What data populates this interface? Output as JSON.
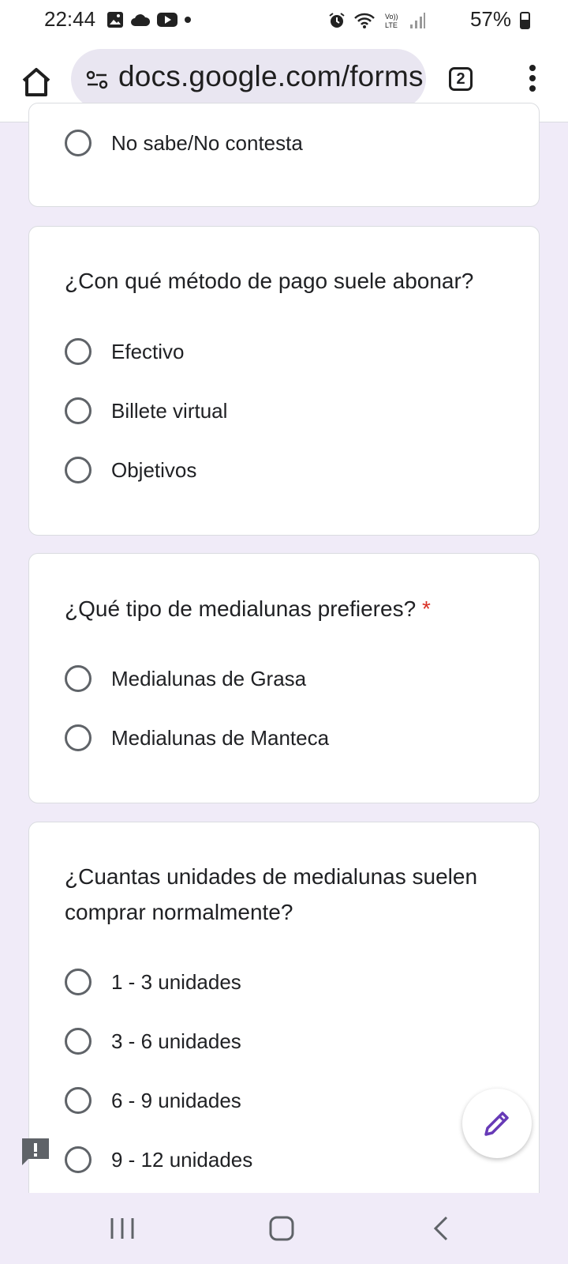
{
  "status_bar": {
    "time": "22:44",
    "battery": "57%",
    "left_icons": [
      "gallery-icon",
      "cloud-icon",
      "youtube-icon",
      "dot-icon"
    ],
    "right_icons": [
      "alarm-icon",
      "wifi-icon",
      "volte-icon",
      "signal-icon",
      "battery-icon"
    ]
  },
  "browser": {
    "url": "docs.google.com/forms",
    "tab_count": "2"
  },
  "form": {
    "partial_option": "No sabe/No contesta",
    "q1": {
      "question": "¿Con qué método de pago suele abonar?",
      "options": [
        "Efectivo",
        "Billete virtual",
        "Objetivos"
      ]
    },
    "q2": {
      "question": "¿Qué tipo de medialunas prefieres?",
      "required_mark": "*",
      "options": [
        "Medialunas de Grasa",
        "Medialunas de Manteca"
      ]
    },
    "q3": {
      "question": "¿Cuantas unidades de medialunas suelen comprar normalmente?",
      "options": [
        "1 - 3 unidades",
        "3 - 6 unidades",
        "6 - 9 unidades",
        "9 - 12 unidades"
      ]
    }
  },
  "colors": {
    "background": "#f0ebf8",
    "accent": "#673ab7",
    "required": "#d93025"
  }
}
